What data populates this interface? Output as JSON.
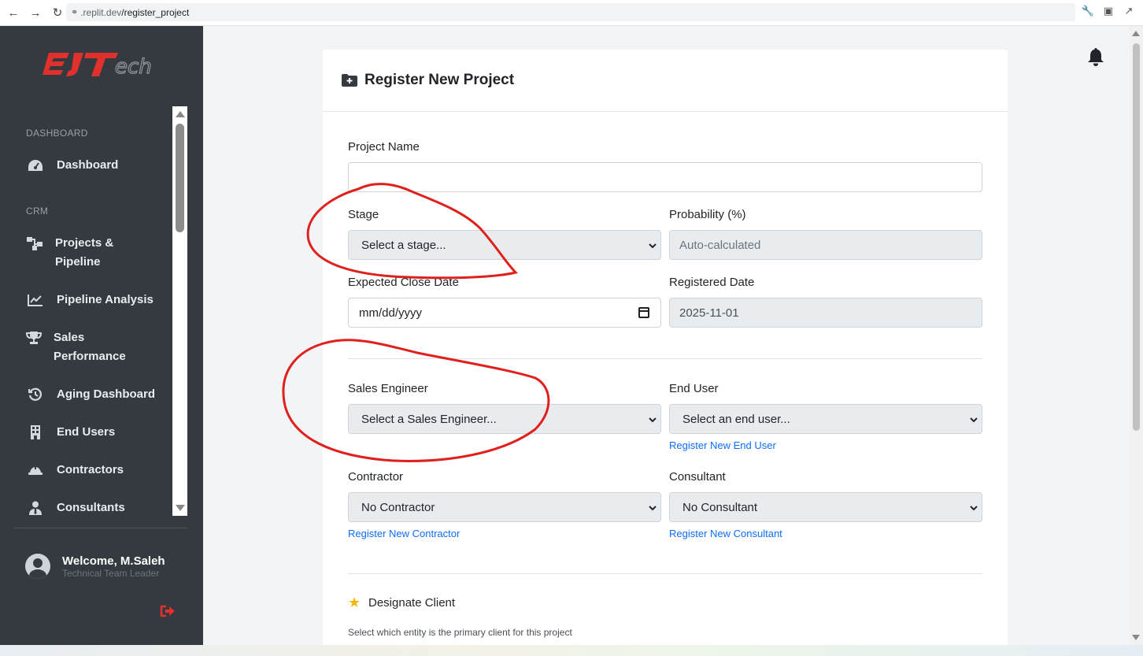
{
  "browser": {
    "url_prefix": ".replit.dev",
    "url_path": "/register_project"
  },
  "sidebar": {
    "logo_text": "EJTech",
    "sections": [
      {
        "title": "DASHBOARD"
      },
      {
        "title": "CRM"
      }
    ],
    "items": [
      {
        "label": "Dashboard",
        "icon": "gauge-icon"
      },
      {
        "label": "Projects & Pipeline",
        "icon": "sitemap-icon"
      },
      {
        "label": "Pipeline Analysis",
        "icon": "chart-line-icon"
      },
      {
        "label": "Sales Performance",
        "icon": "trophy-icon"
      },
      {
        "label": "Aging Dashboard",
        "icon": "history-icon"
      },
      {
        "label": "End Users",
        "icon": "building-icon"
      },
      {
        "label": "Contractors",
        "icon": "hard-hat-icon"
      },
      {
        "label": "Consultants",
        "icon": "user-tie-icon"
      }
    ],
    "user": {
      "welcome": "Welcome, M.Saleh",
      "role": "Technical Team Leader"
    }
  },
  "form": {
    "title": "Register New Project",
    "project_name": {
      "label": "Project Name",
      "value": ""
    },
    "stage": {
      "label": "Stage",
      "value": "Select a stage..."
    },
    "probability": {
      "label": "Probability (%)",
      "placeholder": "Auto-calculated"
    },
    "expected_close": {
      "label": "Expected Close Date",
      "placeholder": "mm/dd/yyyy"
    },
    "registered_date": {
      "label": "Registered Date",
      "value": "2025-11-01"
    },
    "sales_engineer": {
      "label": "Sales Engineer",
      "value": "Select a Sales Engineer..."
    },
    "end_user": {
      "label": "End User",
      "value": "Select an end user...",
      "link": "Register New End User"
    },
    "contractor": {
      "label": "Contractor",
      "value": "No Contractor",
      "link": "Register New Contractor"
    },
    "consultant": {
      "label": "Consultant",
      "value": "No Consultant",
      "link": "Register New Consultant"
    },
    "designate": {
      "title": "Designate Client",
      "note": "Select which entity is the primary client for this project"
    }
  },
  "colors": {
    "sidebar_bg": "#343a40",
    "brand_red": "#e0312c",
    "link_blue": "#0d6efd",
    "annotation_red": "#e0201c"
  }
}
